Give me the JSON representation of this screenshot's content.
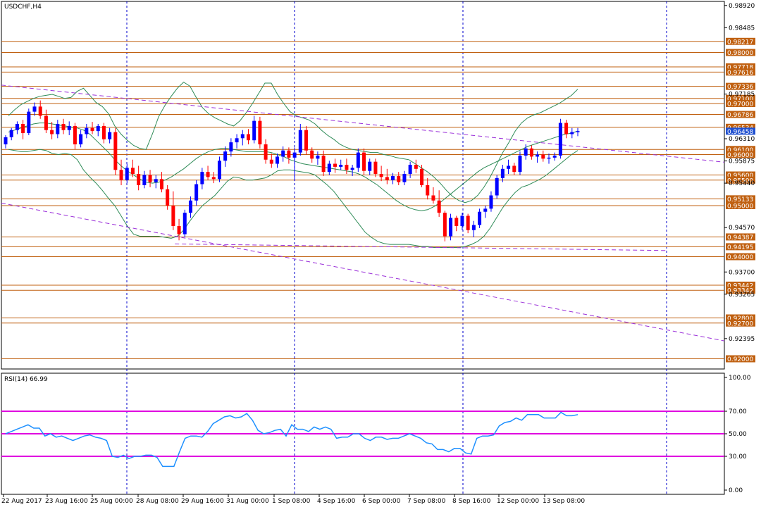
{
  "window": {
    "symbol_title": "USDCHF,H4",
    "indicator_title": "RSI(14) 66.99"
  },
  "colors": {
    "bull": "#0000ff",
    "bear": "#ff0000",
    "bollinger": "#2e8b57",
    "trend": "#9b30d9",
    "level": "#c06010",
    "rsi": "#1e90ff",
    "rsi_levels": "#e000e0",
    "vgrid": "#0000cc",
    "current_price_bg": "#2050d0"
  },
  "chart_data": [
    {
      "type": "candlestick",
      "title": "USDCHF,H4",
      "ylim": [
        0.918,
        0.99
      ],
      "price_axis_ticks": [
        "0.98920",
        "0.98485",
        "0.97185",
        "0.96310",
        "0.95875",
        "0.95440",
        "0.94570",
        "0.93700",
        "0.93265",
        "0.92395"
      ],
      "level_labels": [
        {
          "label": "0.98217",
          "price": 0.98217
        },
        {
          "label": "0.98000",
          "price": 0.98
        },
        {
          "label": "0.97718",
          "price": 0.97718
        },
        {
          "label": "0.97616",
          "price": 0.97616
        },
        {
          "label": "0.97336",
          "price": 0.97336
        },
        {
          "label": "0.97100",
          "price": 0.971
        },
        {
          "label": "0.97000",
          "price": 0.97
        },
        {
          "label": "0.96786",
          "price": 0.96786
        },
        {
          "label": "0.96534",
          "price": 0.96534
        },
        {
          "label": "0.96100",
          "price": 0.961
        },
        {
          "label": "0.96000",
          "price": 0.96
        },
        {
          "label": "0.95600",
          "price": 0.956
        },
        {
          "label": "0.95500",
          "price": 0.955
        },
        {
          "label": "0.95133",
          "price": 0.95133
        },
        {
          "label": "0.95000",
          "price": 0.95
        },
        {
          "label": "0.94387",
          "price": 0.94387
        },
        {
          "label": "0.94195",
          "price": 0.94195
        },
        {
          "label": "0.94000",
          "price": 0.94
        },
        {
          "label": "0.93442",
          "price": 0.93442
        },
        {
          "label": "0.93342",
          "price": 0.93342
        },
        {
          "label": "0.92800",
          "price": 0.928
        },
        {
          "label": "0.92700",
          "price": 0.927
        },
        {
          "label": "0.92000",
          "price": 0.92
        }
      ],
      "current_price": "0.96458",
      "x_labels": [
        "22 Aug 2017",
        "23 Aug 16:00",
        "25 Aug 00:00",
        "28 Aug 08:00",
        "29 Aug 16:00",
        "31 Aug 00:00",
        "1 Sep 08:00",
        "4 Sep 16:00",
        "6 Sep 00:00",
        "7 Sep 08:00",
        "8 Sep 16:00",
        "12 Sep 00:00",
        "13 Sep 08:00"
      ],
      "candles": [
        [
          0.962,
          0.9638,
          0.9612,
          0.9634
        ],
        [
          0.9634,
          0.9652,
          0.9628,
          0.9648
        ],
        [
          0.9648,
          0.9665,
          0.964,
          0.966
        ],
        [
          0.966,
          0.9668,
          0.963,
          0.9642
        ],
        [
          0.9642,
          0.969,
          0.9638,
          0.9684
        ],
        [
          0.9684,
          0.9702,
          0.9676,
          0.9694
        ],
        [
          0.9694,
          0.9706,
          0.967,
          0.9676
        ],
        [
          0.9676,
          0.9688,
          0.9642,
          0.9648
        ],
        [
          0.9648,
          0.9664,
          0.963,
          0.964
        ],
        [
          0.964,
          0.9668,
          0.9632,
          0.966
        ],
        [
          0.966,
          0.967,
          0.964,
          0.9648
        ],
        [
          0.9648,
          0.9665,
          0.9638,
          0.9656
        ],
        [
          0.9656,
          0.9662,
          0.961,
          0.962
        ],
        [
          0.962,
          0.9648,
          0.9614,
          0.964
        ],
        [
          0.964,
          0.966,
          0.9632,
          0.9652
        ],
        [
          0.9652,
          0.9664,
          0.964,
          0.9646
        ],
        [
          0.9646,
          0.966,
          0.9636,
          0.9656
        ],
        [
          0.9656,
          0.9662,
          0.9622,
          0.963
        ],
        [
          0.963,
          0.9652,
          0.9622,
          0.9644
        ],
        [
          0.9644,
          0.9652,
          0.956,
          0.957
        ],
        [
          0.957,
          0.959,
          0.954,
          0.955
        ],
        [
          0.955,
          0.9582,
          0.9544,
          0.9574
        ],
        [
          0.9574,
          0.959,
          0.9556,
          0.9562
        ],
        [
          0.9562,
          0.9578,
          0.953,
          0.954
        ],
        [
          0.954,
          0.9568,
          0.9534,
          0.956
        ],
        [
          0.956,
          0.957,
          0.9536,
          0.9546
        ],
        [
          0.9546,
          0.956,
          0.9534,
          0.9552
        ],
        [
          0.9552,
          0.9566,
          0.9526,
          0.9532
        ],
        [
          0.9532,
          0.954,
          0.9492,
          0.95
        ],
        [
          0.95,
          0.9528,
          0.9452,
          0.946
        ],
        [
          0.946,
          0.9474,
          0.9432,
          0.9444
        ],
        [
          0.9444,
          0.9492,
          0.9438,
          0.9486
        ],
        [
          0.9486,
          0.9518,
          0.9476,
          0.951
        ],
        [
          0.951,
          0.955,
          0.95,
          0.9542
        ],
        [
          0.9542,
          0.9574,
          0.9532,
          0.9566
        ],
        [
          0.9566,
          0.9578,
          0.955,
          0.9556
        ],
        [
          0.9556,
          0.9566,
          0.9544,
          0.9552
        ],
        [
          0.9552,
          0.9596,
          0.9546,
          0.9588
        ],
        [
          0.9588,
          0.9616,
          0.9576,
          0.9606
        ],
        [
          0.9606,
          0.9632,
          0.9596,
          0.9624
        ],
        [
          0.9624,
          0.964,
          0.9612,
          0.9632
        ],
        [
          0.9632,
          0.9648,
          0.9618,
          0.964
        ],
        [
          0.964,
          0.965,
          0.962,
          0.9628
        ],
        [
          0.9628,
          0.9676,
          0.9622,
          0.9666
        ],
        [
          0.9666,
          0.9674,
          0.9612,
          0.962
        ],
        [
          0.962,
          0.963,
          0.9582,
          0.959
        ],
        [
          0.959,
          0.9602,
          0.9574,
          0.9582
        ],
        [
          0.9582,
          0.9602,
          0.9574,
          0.9596
        ],
        [
          0.9596,
          0.9616,
          0.9586,
          0.9608
        ],
        [
          0.9608,
          0.9614,
          0.9582,
          0.9594
        ],
        [
          0.9594,
          0.9614,
          0.9548,
          0.9604
        ],
        [
          0.9604,
          0.966,
          0.9598,
          0.9648
        ],
        [
          0.9648,
          0.9656,
          0.96,
          0.9608
        ],
        [
          0.9608,
          0.9614,
          0.9584,
          0.9592
        ],
        [
          0.9592,
          0.9606,
          0.958,
          0.9598
        ],
        [
          0.9598,
          0.9608,
          0.9558,
          0.9566
        ],
        [
          0.9566,
          0.9588,
          0.956,
          0.9582
        ],
        [
          0.9582,
          0.9592,
          0.9564,
          0.9576
        ],
        [
          0.9576,
          0.959,
          0.957,
          0.958
        ],
        [
          0.958,
          0.9592,
          0.9562,
          0.957
        ],
        [
          0.957,
          0.958,
          0.9558,
          0.9574
        ],
        [
          0.9574,
          0.9612,
          0.9566,
          0.9604
        ],
        [
          0.9604,
          0.9612,
          0.956,
          0.9568
        ],
        [
          0.9568,
          0.9592,
          0.956,
          0.9586
        ],
        [
          0.9586,
          0.9592,
          0.9556,
          0.9562
        ],
        [
          0.9562,
          0.9578,
          0.9548,
          0.9556
        ],
        [
          0.9556,
          0.9572,
          0.9542,
          0.955
        ],
        [
          0.955,
          0.9564,
          0.9542,
          0.9558
        ],
        [
          0.9558,
          0.9566,
          0.954,
          0.9546
        ],
        [
          0.9546,
          0.9568,
          0.954,
          0.9562
        ],
        [
          0.9562,
          0.9586,
          0.9554,
          0.958
        ],
        [
          0.958,
          0.959,
          0.9564,
          0.9572
        ],
        [
          0.9572,
          0.958,
          0.9536,
          0.954
        ],
        [
          0.954,
          0.9554,
          0.9512,
          0.952
        ],
        [
          0.952,
          0.9536,
          0.9504,
          0.951
        ],
        [
          0.951,
          0.953,
          0.9478,
          0.9486
        ],
        [
          0.9486,
          0.949,
          0.943,
          0.944
        ],
        [
          0.944,
          0.9484,
          0.9432,
          0.9476
        ],
        [
          0.9476,
          0.948,
          0.945,
          0.946
        ],
        [
          0.946,
          0.9486,
          0.9452,
          0.948
        ],
        [
          0.948,
          0.9484,
          0.9446,
          0.9452
        ],
        [
          0.9452,
          0.947,
          0.9438,
          0.9462
        ],
        [
          0.9462,
          0.9494,
          0.9456,
          0.9488
        ],
        [
          0.9488,
          0.95,
          0.9476,
          0.9494
        ],
        [
          0.9494,
          0.9528,
          0.9488,
          0.952
        ],
        [
          0.952,
          0.956,
          0.9514,
          0.9554
        ],
        [
          0.9554,
          0.958,
          0.9546,
          0.9572
        ],
        [
          0.9572,
          0.959,
          0.9562,
          0.9578
        ],
        [
          0.9578,
          0.9584,
          0.956,
          0.9566
        ],
        [
          0.9566,
          0.9606,
          0.956,
          0.9598
        ],
        [
          0.9598,
          0.962,
          0.959,
          0.9612
        ],
        [
          0.9612,
          0.9618,
          0.959,
          0.9596
        ],
        [
          0.9596,
          0.9606,
          0.9584,
          0.96
        ],
        [
          0.96,
          0.9608,
          0.9586,
          0.9592
        ],
        [
          0.9592,
          0.9602,
          0.9582,
          0.9594
        ],
        [
          0.9594,
          0.9604,
          0.9588,
          0.9598
        ],
        [
          0.9598,
          0.967,
          0.9592,
          0.9662
        ],
        [
          0.9662,
          0.9668,
          0.9632,
          0.964
        ],
        [
          0.964,
          0.9652,
          0.9632,
          0.9644
        ],
        [
          0.9644,
          0.9652,
          0.9636,
          0.9646
        ]
      ],
      "bollinger": {
        "upper": [
          0.9676,
          0.9688,
          0.9698,
          0.9704,
          0.971,
          0.9714,
          0.9716,
          0.9718,
          0.9714,
          0.971,
          0.9712,
          0.9724,
          0.973,
          0.9716,
          0.9702,
          0.9694,
          0.968,
          0.9656,
          0.964,
          0.9628,
          0.9618,
          0.9612,
          0.961,
          0.964,
          0.9674,
          0.9696,
          0.9714,
          0.973,
          0.9742,
          0.9734,
          0.9712,
          0.9692,
          0.968,
          0.9672,
          0.9666,
          0.966,
          0.9656,
          0.9666,
          0.9682,
          0.97,
          0.972,
          0.974,
          0.974,
          0.9718,
          0.97,
          0.9684,
          0.9676,
          0.9672,
          0.9668,
          0.966,
          0.9648,
          0.9638,
          0.963,
          0.962,
          0.9614,
          0.961,
          0.9608,
          0.9606,
          0.9604,
          0.9604,
          0.96,
          0.9598,
          0.9594,
          0.9592,
          0.959,
          0.9582,
          0.9574,
          0.9566,
          0.9556,
          0.9544,
          0.953,
          0.9518,
          0.951,
          0.9506,
          0.951,
          0.952,
          0.9536,
          0.9556,
          0.958,
          0.9604,
          0.9624,
          0.9646,
          0.9662,
          0.9672,
          0.9678,
          0.9682,
          0.9688,
          0.9694,
          0.97,
          0.9708,
          0.9716,
          0.9728
        ],
        "middle": [
          0.9644,
          0.9648,
          0.9652,
          0.9656,
          0.966,
          0.9662,
          0.9662,
          0.966,
          0.9658,
          0.9656,
          0.9654,
          0.9652,
          0.9648,
          0.964,
          0.9628,
          0.9616,
          0.9604,
          0.959,
          0.9578,
          0.9568,
          0.956,
          0.9552,
          0.9546,
          0.9544,
          0.9546,
          0.955,
          0.9556,
          0.9564,
          0.9572,
          0.9582,
          0.9592,
          0.96,
          0.9606,
          0.961,
          0.9612,
          0.9612,
          0.961,
          0.9608,
          0.9606,
          0.9606,
          0.9606,
          0.9606,
          0.9604,
          0.96,
          0.9596,
          0.959,
          0.9586,
          0.9582,
          0.958,
          0.9578,
          0.9576,
          0.9574,
          0.9572,
          0.957,
          0.9568,
          0.9566,
          0.9562,
          0.9556,
          0.9548,
          0.954,
          0.953,
          0.952,
          0.951,
          0.9502,
          0.9496,
          0.9492,
          0.949,
          0.9492,
          0.9498,
          0.9506,
          0.9516,
          0.9526,
          0.9536,
          0.9546,
          0.9556,
          0.9566,
          0.9574,
          0.958,
          0.9586,
          0.9592,
          0.9598,
          0.9604,
          0.961,
          0.9616,
          0.962,
          0.9624,
          0.9628,
          0.9632,
          0.9636,
          0.964,
          0.9642,
          0.9646
        ],
        "lower": [
          0.961,
          0.9608,
          0.9606,
          0.9606,
          0.9608,
          0.961,
          0.9608,
          0.9602,
          0.96,
          0.9602,
          0.96,
          0.959,
          0.957,
          0.9556,
          0.9544,
          0.953,
          0.9514,
          0.95,
          0.948,
          0.946,
          0.9444,
          0.944,
          0.944,
          0.944,
          0.944,
          0.9438,
          0.9436,
          0.944,
          0.9452,
          0.947,
          0.9486,
          0.95,
          0.951,
          0.952,
          0.9534,
          0.9548,
          0.9556,
          0.9554,
          0.955,
          0.955,
          0.9552,
          0.9554,
          0.956,
          0.9568,
          0.957,
          0.957,
          0.9568,
          0.9566,
          0.9564,
          0.956,
          0.955,
          0.954,
          0.9528,
          0.9512,
          0.9496,
          0.948,
          0.9464,
          0.9448,
          0.9438,
          0.943,
          0.9426,
          0.9424,
          0.9424,
          0.9424,
          0.9424,
          0.9422,
          0.942,
          0.942,
          0.9418,
          0.9418,
          0.9418,
          0.9418,
          0.9418,
          0.942,
          0.9424,
          0.943,
          0.944,
          0.9456,
          0.9476,
          0.9496,
          0.9512,
          0.9526,
          0.9536,
          0.954,
          0.9546,
          0.9552,
          0.956,
          0.957,
          0.958,
          0.959,
          0.96,
          0.9608
        ]
      },
      "trend_lines": [
        {
          "from": [
            0,
            0.9736
          ],
          "to": [
            1,
            0.9585
          ]
        },
        {
          "from": [
            0,
            0.9505
          ],
          "to": [
            1,
            0.9235
          ]
        },
        {
          "from": [
            0.24,
            0.9425
          ],
          "to": [
            0.92,
            0.9412
          ]
        }
      ]
    },
    {
      "type": "line",
      "title": "RSI(14) 66.99",
      "ylim": [
        0,
        100
      ],
      "y_ticks": [
        "100.00",
        "70.00",
        "50.00",
        "30.00",
        "0.00"
      ],
      "levels": [
        70,
        50,
        30
      ],
      "values": [
        50,
        52,
        54,
        56,
        58,
        55,
        55,
        48,
        50,
        47,
        48,
        46,
        44,
        46,
        48,
        49,
        47,
        46,
        44,
        30,
        29,
        31,
        28,
        30,
        30,
        31,
        31,
        29,
        21,
        21,
        21,
        34,
        46,
        48,
        48,
        47,
        52,
        59,
        62,
        65,
        66,
        64,
        65,
        68,
        62,
        53,
        50,
        51,
        53,
        54,
        48,
        58,
        54,
        54,
        52,
        56,
        54,
        56,
        54,
        46,
        47,
        47,
        50,
        50,
        46,
        44,
        47,
        47,
        45,
        46,
        46,
        48,
        50,
        48,
        46,
        42,
        41,
        36,
        36,
        34,
        37,
        37,
        33,
        32,
        46,
        48,
        48,
        49,
        57,
        60,
        61,
        64,
        62,
        67,
        67,
        67,
        64,
        64,
        64,
        69,
        66,
        66,
        67
      ]
    }
  ]
}
